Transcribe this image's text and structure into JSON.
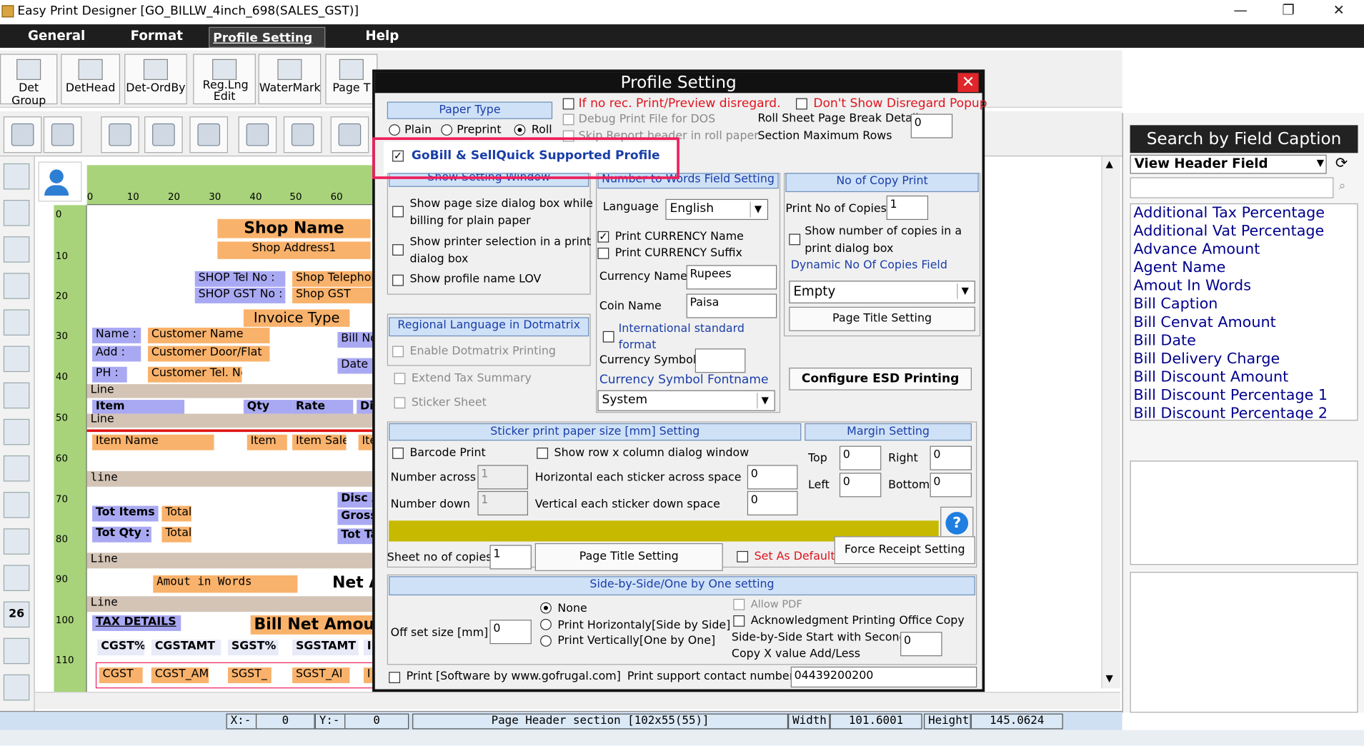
{
  "window": {
    "title": "Easy Print Designer [GO_BILLW_4inch_698(SALES_GST)]",
    "min": "—",
    "max": "❐",
    "close": "✕"
  },
  "menu": [
    "General",
    "Format",
    "Profile Setting",
    "Help"
  ],
  "toolbar": [
    "Det Group",
    "DetHead",
    "Det-OrdBy",
    "Reg.Lng Edit",
    "WaterMark",
    "Page T"
  ],
  "design": {
    "shop_name": "Shop Name",
    "shop_address": "Shop Address1",
    "tel_label": "SHOP Tel No   :",
    "gst_label": "SHOP GST No :",
    "tel_val": "Shop Telephon",
    "gst_val": "Shop GST",
    "invoice_type": "Invoice Type",
    "name_label": "Name :",
    "add_label": "Add :",
    "ph_label": "PH :",
    "cust_name": "Customer Name",
    "cust_door": "Customer Door/Flat",
    "cust_tel": "Customer Tel. No",
    "bill_no": "Bill No",
    "date": "Date :",
    "line": "Line",
    "item": "Item",
    "qty": "Qty",
    "rate": "Rate",
    "di": "Di",
    "line2": "Line",
    "item_name": "Item Name",
    "item_sale": "Item Sale",
    "ite": "Ite",
    "line3": "line",
    "disc": "Disc A",
    "gross": "Gross",
    "tot_items": "Tot Items :",
    "total": "Total",
    "tot_qty": "Tot Qty  :",
    "total2": "Total",
    "tot_ta": "Tot Ta",
    "line4": "Line",
    "amt_words": "Amout in Words",
    "net": "Net A",
    "line5": "Line",
    "tax_details": "TAX DETAILS",
    "bill_net": "Bill Net Amoun",
    "cgst_p": "CGST%",
    "cgstamt": "CGSTAMT",
    "sgst_p": "SGST%",
    "sgstamt": "SGSTAMT",
    "i": "I",
    "cgst": "CGST",
    "cgst_a": "CGST_AM",
    "sgst": "SGST_",
    "sgst_a": "SGST_AI",
    "i2": "I"
  },
  "ruler_h": [
    "0",
    "10",
    "20",
    "30",
    "40",
    "50",
    "60"
  ],
  "ruler_v": [
    "0",
    "10",
    "20",
    "30",
    "40",
    "50",
    "60",
    "70",
    "80",
    "90",
    "100",
    "110"
  ],
  "left_badge": "26",
  "status": {
    "x_label": "X:-",
    "x_val": "0",
    "y_label": "Y:-",
    "y_val": "0",
    "section": "Page Header section [102x55(55)]",
    "width_label": "Width",
    "width_val": "101.6001",
    "height_label": "Height",
    "height_val": "145.0624"
  },
  "right": {
    "title": "Search by Field Caption",
    "select": "View Header Field",
    "items": [
      "Additional Tax Percentage",
      "Additional Vat Percentage",
      "Advance Amount",
      "Agent Name",
      "Amout In Words",
      "Bill Caption",
      "Bill Cenvat Amount",
      "Bill Date",
      "Bill Delivery Charge",
      "Bill Discount Amount",
      "Bill Discount Percentage 1",
      "Bill Discount Percentage 2"
    ]
  },
  "dialog": {
    "title": "Profile Setting",
    "close": "✕",
    "paper_type": "Paper Type",
    "plain": "Plain",
    "preprint": "Preprint",
    "roll": "Roll",
    "no_rec": "If no rec. Print/Preview disregard.",
    "dont_show": "Don't Show Disregard Popup",
    "debug": "Debug Print File for DOS",
    "roll_sheet": "Roll Sheet Page Break Detail",
    "skip": "Skip Report header in roll paper",
    "section_max": "Section Maximum Rows",
    "max_rows": "0",
    "gobill": "GoBill & SellQuick Supported Profile",
    "show_setting": "Show Setting Window",
    "show_page": "Show page size dialog box while",
    "billing": "billing for plain paper",
    "show_printer": "Show printer selection in a print",
    "dialog_box": "dialog box",
    "show_profile": "Show profile name LOV",
    "num_words": "Number to Words Field Setting",
    "language": "Language",
    "lang_val": "English",
    "print_currency": "Print CURRENCY Name",
    "print_suffix": "Print CURRENCY Suffix",
    "currency_name": "Currency Name",
    "currency_val": "Rupees",
    "coin_name": "Coin Name",
    "coin_val": "Paisa",
    "intl": "International standard",
    "format": "format",
    "currency_symbol": "Currency Symbol",
    "symbol_font": "Currency Symbol Fontname",
    "font_val": "System",
    "copy_print": "No of Copy Print",
    "print_copies": "Print No of Copies",
    "copies_val": "1",
    "show_copies": "Show number of copies in a",
    "print_dialog": "print dialog box",
    "dynamic": "Dynamic No Of Copies Field",
    "empty": "Empty",
    "page_title": "Page Title Setting",
    "esd": "Configure ESD Printing",
    "regional": "Regional Language in Dotmatrix",
    "enable_dot": "Enable Dotmatrix Printing",
    "extend_tax": "Extend Tax Summary",
    "sticker_sheet": "Sticker Sheet",
    "sticker_hdr": "Sticker print paper size [mm] Setting",
    "barcode": "Barcode Print",
    "show_row": "Show row x column dialog window",
    "num_across": "Number across",
    "across_val": "1",
    "horiz": "Horizontal each sticker across space",
    "horiz_val": "0",
    "num_down": "Number down",
    "down_val": "1",
    "vert": "Vertical each sticker down space",
    "vert_val": "0",
    "margin": "Margin Setting",
    "top": "Top",
    "top_val": "0",
    "right_l": "Right",
    "right_val": "0",
    "left_l": "Left",
    "left_val": "0",
    "bottom": "Bottom",
    "bottom_val": "0",
    "help": "?",
    "sheet_copies": "Sheet no of copies",
    "sheet_val": "1",
    "page_title2": "Page Title Setting",
    "set_default": "Set As Default",
    "force": "Force Receipt Setting",
    "side_hdr": "Side-by-Side/One by One setting",
    "none": "None",
    "horiz_side": "Print Horizontaly[Side by Side]",
    "vert_one": "Print Vertically[One by One]",
    "offset": "Off set size [mm]",
    "offset_val": "0",
    "allow_pdf": "Allow PDF",
    "ack": "Acknowledgment Printing Office Copy",
    "side_start": "Side-by-Side Start with Second",
    "copy_x": "Copy X value Add/Less",
    "copyx_val": "0",
    "print_sw": "Print [Software by www.gofrugal.com]",
    "support": "Print support contact number",
    "support_val": "04439200200"
  }
}
